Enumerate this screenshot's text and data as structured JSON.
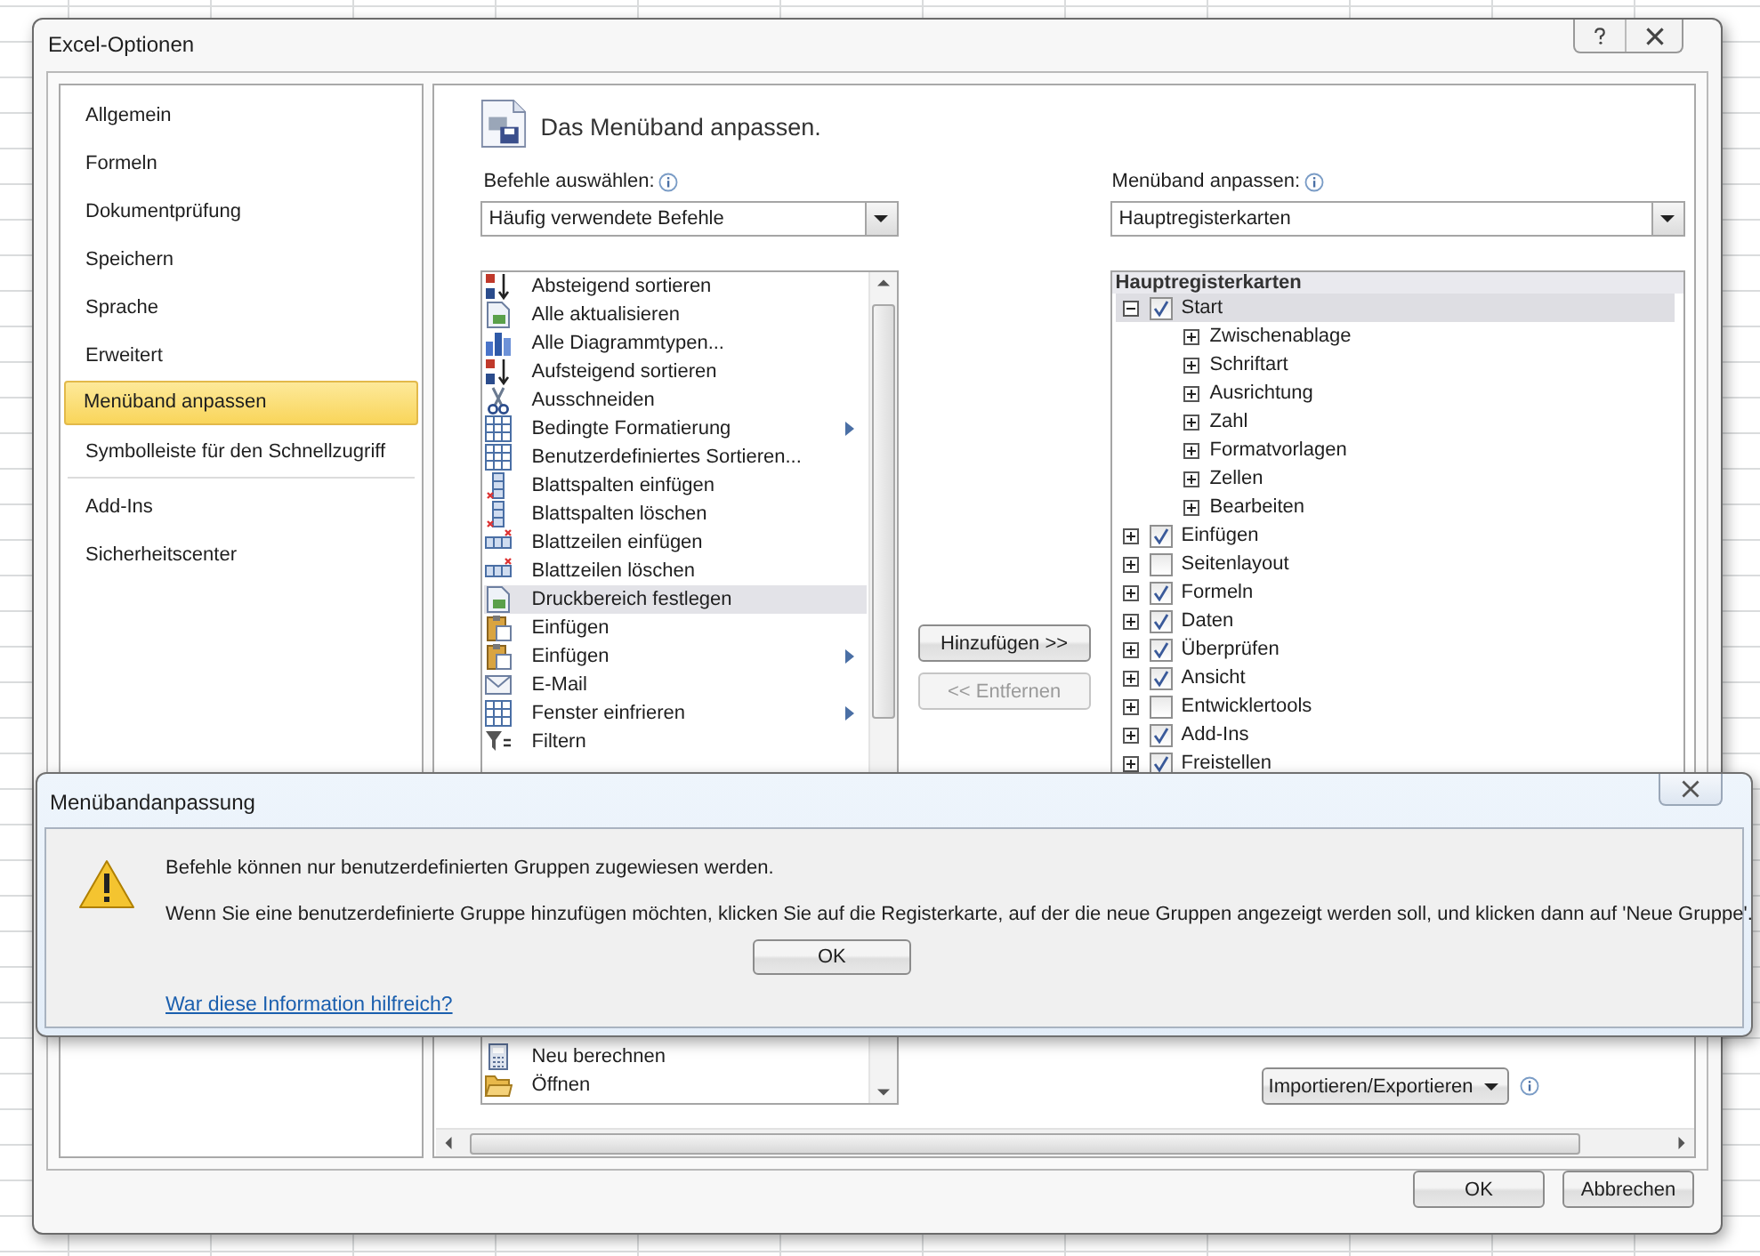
{
  "window": {
    "title": "Excel-Optionen"
  },
  "sidebar": {
    "groups": [
      {
        "items": [
          {
            "label": "Allgemein",
            "selected": false
          },
          {
            "label": "Formeln",
            "selected": false
          },
          {
            "label": "Dokumentprüfung",
            "selected": false
          },
          {
            "label": "Speichern",
            "selected": false
          },
          {
            "label": "Sprache",
            "selected": false
          },
          {
            "label": "Erweitert",
            "selected": false
          },
          {
            "label": "Menüband anpassen",
            "selected": true
          },
          {
            "label": "Symbolleiste für den Schnellzugriff",
            "selected": false
          }
        ]
      },
      {
        "items": [
          {
            "label": "Add-Ins",
            "selected": false
          },
          {
            "label": "Sicherheitscenter",
            "selected": false
          }
        ]
      }
    ]
  },
  "content": {
    "heading": "Das Menüband anpassen.",
    "commands": {
      "label": "Befehle auswählen:",
      "dropdown": "Häufig verwendete Befehle",
      "items": [
        {
          "label": "Absteigend sortieren",
          "selected": false,
          "submenu": false
        },
        {
          "label": "Alle aktualisieren",
          "selected": false,
          "submenu": false
        },
        {
          "label": "Alle Diagrammtypen...",
          "selected": false,
          "submenu": false
        },
        {
          "label": "Aufsteigend sortieren",
          "selected": false,
          "submenu": false
        },
        {
          "label": "Ausschneiden",
          "selected": false,
          "submenu": false
        },
        {
          "label": "Bedingte Formatierung",
          "selected": false,
          "submenu": true
        },
        {
          "label": "Benutzerdefiniertes Sortieren...",
          "selected": false,
          "submenu": false
        },
        {
          "label": "Blattspalten einfügen",
          "selected": false,
          "submenu": false
        },
        {
          "label": "Blattspalten löschen",
          "selected": false,
          "submenu": false
        },
        {
          "label": "Blattzeilen einfügen",
          "selected": false,
          "submenu": false
        },
        {
          "label": "Blattzeilen löschen",
          "selected": false,
          "submenu": false
        },
        {
          "label": "Druckbereich festlegen",
          "selected": true,
          "submenu": false
        },
        {
          "label": "Einfügen",
          "selected": false,
          "submenu": false
        },
        {
          "label": "Einfügen",
          "selected": false,
          "submenu": true
        },
        {
          "label": "E-Mail",
          "selected": false,
          "submenu": false
        },
        {
          "label": "Fenster einfrieren",
          "selected": false,
          "submenu": true
        },
        {
          "label": "Filtern",
          "selected": false,
          "submenu": false
        }
      ],
      "items_after": [
        {
          "label": "Neu berechnen",
          "selected": false,
          "submenu": false
        },
        {
          "label": "Öffnen",
          "selected": false,
          "submenu": false
        }
      ]
    },
    "add_button": {
      "label": "Hinzufügen >>",
      "disabled": false
    },
    "remove_button": {
      "label": "<< Entfernen",
      "disabled": true
    },
    "ribbon": {
      "label": "Menüband anpassen:",
      "dropdown": "Hauptregisterkarten",
      "tree_header": "Hauptregisterkarten",
      "tabs": [
        {
          "label": "Start",
          "checked": true,
          "expanded": true,
          "selected": true,
          "children": [
            {
              "label": "Zwischenablage",
              "expanded": false
            },
            {
              "label": "Schriftart",
              "expanded": false
            },
            {
              "label": "Ausrichtung",
              "expanded": false
            },
            {
              "label": "Zahl",
              "expanded": false
            },
            {
              "label": "Formatvorlagen",
              "expanded": false
            },
            {
              "label": "Zellen",
              "expanded": false
            },
            {
              "label": "Bearbeiten",
              "expanded": false
            }
          ]
        },
        {
          "label": "Einfügen",
          "checked": true,
          "expanded": false,
          "selected": false
        },
        {
          "label": "Seitenlayout",
          "checked": false,
          "expanded": false,
          "selected": false
        },
        {
          "label": "Formeln",
          "checked": true,
          "expanded": false,
          "selected": false
        },
        {
          "label": "Daten",
          "checked": true,
          "expanded": false,
          "selected": false
        },
        {
          "label": "Überprüfen",
          "checked": true,
          "expanded": false,
          "selected": false
        },
        {
          "label": "Ansicht",
          "checked": true,
          "expanded": false,
          "selected": false
        },
        {
          "label": "Entwicklertools",
          "checked": false,
          "expanded": false,
          "selected": false
        },
        {
          "label": "Add-Ins",
          "checked": true,
          "expanded": false,
          "selected": false
        },
        {
          "label": "Freistellen",
          "checked": true,
          "expanded": false,
          "selected": false
        }
      ]
    },
    "customizations": {
      "import_export_button": "Importieren/Exportieren"
    }
  },
  "buttons": [
    "OK",
    "Abbrechen"
  ],
  "message_box": {
    "title": "Menübandanpassung",
    "lines": [
      "Befehle können nur benutzerdefinierten Gruppen zugewiesen werden.",
      "Wenn Sie eine benutzerdefinierte Gruppe hinzufügen möchten, klicken Sie auf die Registerkarte, auf der die neue Gruppen angezeigt werden soll, und klicken dann auf 'Neue Gruppe'."
    ],
    "button": "OK",
    "link": "War diese Information hilfreich?"
  }
}
